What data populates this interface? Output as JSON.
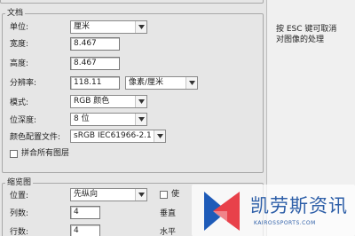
{
  "document_section": {
    "legend": "文档",
    "unit_label": "单位:",
    "unit_value": "厘米",
    "width_label": "宽度:",
    "width_value": "8.467",
    "height_label": "高度:",
    "height_value": "8.467",
    "resolution_label": "分辨率:",
    "resolution_value": "118.11",
    "resolution_unit": "像素/厘米",
    "mode_label": "模式:",
    "mode_value": "RGB 颜色",
    "depth_label": "位深度:",
    "depth_value": "8 位",
    "profile_label": "颜色配置文件:",
    "profile_value": "sRGB IEC61966-2.1",
    "flatten_label": "拼合所有图层"
  },
  "thumbnail_section": {
    "legend": "缩览图",
    "position_label": "位置:",
    "position_value": "先纵向",
    "use_label": "使",
    "columns_label": "列数:",
    "columns_value": "4",
    "rows_label": "行数:",
    "rows_value": "4",
    "vertical_label": "垂直",
    "horizontal_label": "水平"
  },
  "hint": {
    "line1": "按 ESC 键可取消",
    "line2": "对图像的处理"
  },
  "watermark": {
    "text": "凯劳斯资讯",
    "url": "KAIROSSPORTS.COM",
    "colors": {
      "blue": "#1e5bb8",
      "red": "#e8414a",
      "text": "#2e5fa8"
    }
  }
}
